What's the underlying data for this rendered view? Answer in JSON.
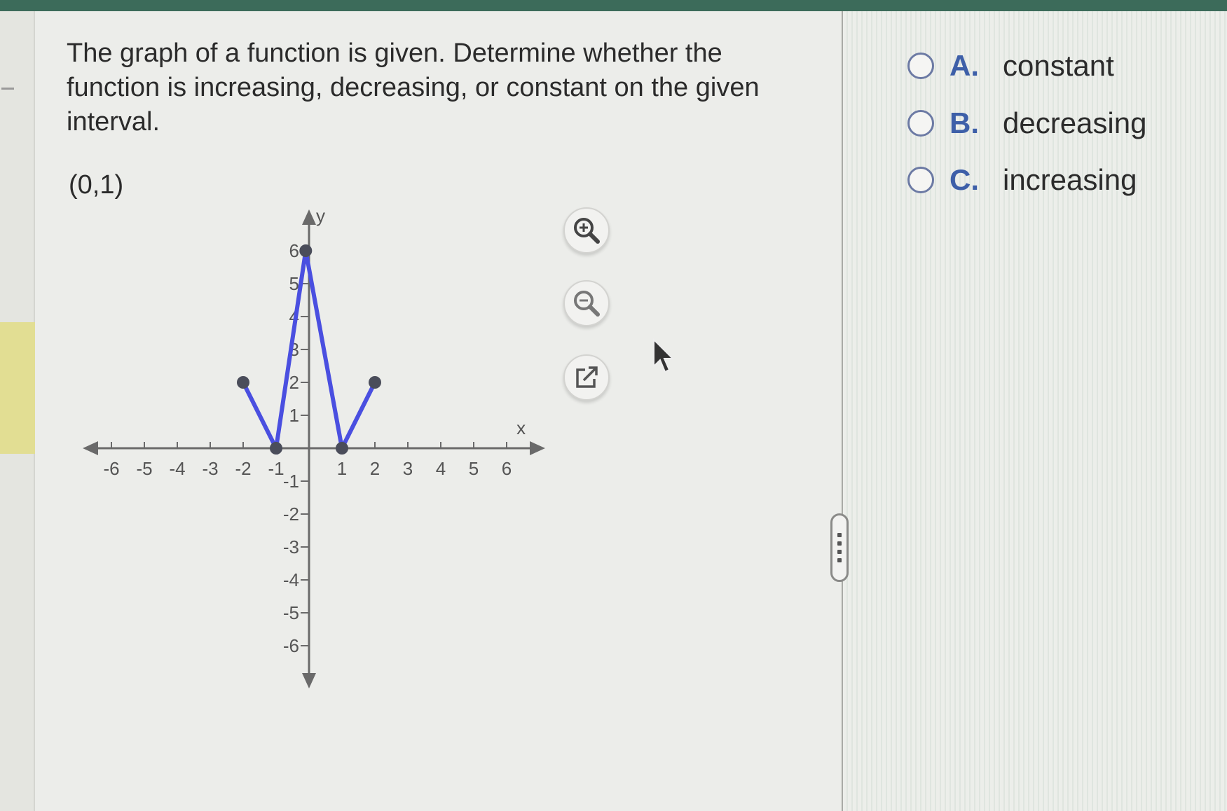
{
  "question": {
    "prompt": "The graph of a function is given. Determine whether the function is increasing, decreasing, or constant on the given interval.",
    "interval": "(0,1)"
  },
  "graph": {
    "x_axis_label": "x",
    "y_axis_label": "y",
    "x_tick_labels": [
      "-6",
      "-5",
      "-4",
      "-3",
      "-2",
      "-1",
      "1",
      "2",
      "3",
      "4",
      "5",
      "6"
    ],
    "y_tick_labels": [
      "6",
      "5",
      "4",
      "3",
      "2",
      "1",
      "-1",
      "-2",
      "-3",
      "-4",
      "-5",
      "-6"
    ],
    "line_color": "#4a4fe0",
    "point_color": "#4a4d5a"
  },
  "chart_data": {
    "type": "line",
    "series": [
      {
        "x": [
          -2,
          -1,
          -0.1,
          1,
          2
        ],
        "y": [
          2,
          0,
          6,
          0,
          2
        ]
      }
    ],
    "closed_points": [
      [
        -2,
        2
      ],
      [
        -1,
        0
      ],
      [
        -0.1,
        6
      ],
      [
        1,
        0
      ],
      [
        2,
        2
      ]
    ],
    "xlim": [
      -6,
      6
    ],
    "ylim": [
      -6,
      6
    ]
  },
  "tools": {
    "zoom_in_icon": "zoom-in-magnifier",
    "zoom_out_icon": "zoom-out-magnifier",
    "popout_icon": "external-link"
  },
  "choices": [
    {
      "letter": "A.",
      "text": "constant"
    },
    {
      "letter": "B.",
      "text": "decreasing"
    },
    {
      "letter": "C.",
      "text": "increasing"
    }
  ],
  "colors": {
    "accent": "#3d5fa8",
    "top_bar": "#3c6b5a",
    "highlight": "#e2de93"
  }
}
